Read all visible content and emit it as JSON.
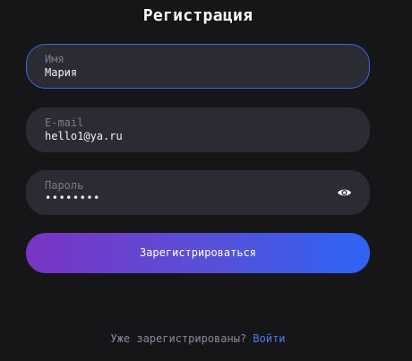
{
  "title": "Регистрация",
  "fields": {
    "name": {
      "label": "Имя",
      "value": "Мария"
    },
    "email": {
      "label": "E-mail",
      "value": "hello1@ya.ru"
    },
    "password": {
      "label": "Пароль",
      "value": "••••••••"
    }
  },
  "submit_label": "Зарегистрироваться",
  "footer": {
    "text": "Уже зарегистрированы?",
    "link": "Войти"
  },
  "colors": {
    "background": "#161618",
    "field": "#2b2b33",
    "focus_border": "#3d63e8",
    "gradient_start": "#7a34c4",
    "gradient_end": "#2e64f5",
    "link": "#4a7cf0"
  },
  "icons": {
    "password_toggle": "eye-icon"
  }
}
